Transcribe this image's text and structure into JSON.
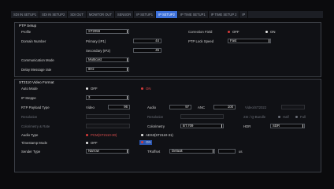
{
  "tabs": [
    "SDI IN SETUP1",
    "SDI IN SETUP2",
    "SDI OUT",
    "MONITOR OUT",
    "SENSOR",
    "IP SETUP1",
    "IP SETUP2",
    "IP TIME SETUP1",
    "IP TIME SETUP 2",
    "IP"
  ],
  "active_tab": "IP SETUP2",
  "ptp": {
    "title": "PTP Setup",
    "profile_label": "Profile",
    "profile_value": "ST2059",
    "domain_label": "Domain Number",
    "primary_label": "Primary (IP1)",
    "primary_value": "44",
    "secondary_label": "Secondary (IP2)",
    "secondary_value": "45",
    "comm_label": "Communication Mode",
    "comm_value": "Multicast",
    "delay_label": "Delay Message rate",
    "delay_value": "8Hz",
    "correction_label": "Correction Field",
    "correction_off": "OFF",
    "correction_on": "ON",
    "lock_label": "PTP Lock Speed",
    "lock_value": "Fast"
  },
  "video": {
    "title": "ST2110 Video Format",
    "auto_label": "Auto Mode",
    "auto_off": "OFF",
    "auto_on": "ON",
    "ip_label": "IP Steppe",
    "ip_value": "3",
    "rtp_label": "RTP Payload Type",
    "rtp_video_label": "Video",
    "rtp_video_value": "96",
    "rtp_audio_label": "Audio",
    "rtp_audio_value": "97",
    "rtp_anc_label": "ANC",
    "rtp_anc_value": "100",
    "rtp_extra_label": "Video/ST2022",
    "row5_label": "Resolution",
    "row5_mid": "Resolution",
    "row5_right_label": "2SI / Q-Bundle",
    "row5_r1": "Half",
    "row5_r2": "Full",
    "row6_label": "Colorimetry & Rate",
    "row6_mid": "Colorimetry",
    "row6_mid_value": "BT.709",
    "row6_hdr_label": "HDR",
    "row6_hdr_value": "SDR",
    "audio_label": "Audio Type",
    "audio_opt1": "PCM(ST2110-30)",
    "audio_opt2": "AES3(ST2110-31)",
    "ts_label": "Timestamp Mode",
    "ts_off": "OFF",
    "ts_on": "ON",
    "sender_label": "Sender Type",
    "sender_value": "Narrow",
    "troffset_label": "TRoffset",
    "troffset_value": "Default",
    "unit": "us"
  }
}
